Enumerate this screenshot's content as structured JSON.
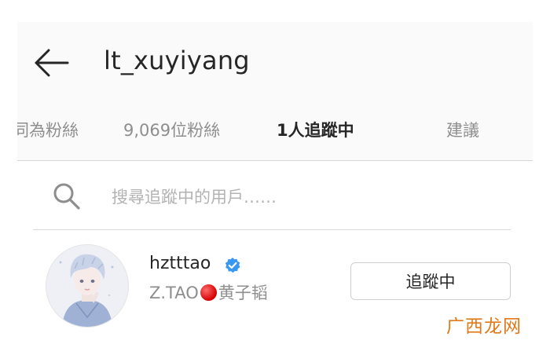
{
  "header": {
    "title": "lt_xuyiyang"
  },
  "tabs": [
    {
      "label": "同為粉絲",
      "active": false
    },
    {
      "label": "9,069位粉絲",
      "active": false
    },
    {
      "label": "1人追蹤中",
      "active": true
    },
    {
      "label": "建議",
      "active": false
    }
  ],
  "search": {
    "placeholder": "搜尋追蹤中的用戶……",
    "value": ""
  },
  "user": {
    "username": "hztttao",
    "verified": true,
    "fullname_prefix": "Z.TAO",
    "fullname_suffix": "黄子韬",
    "button_label": "追蹤中"
  },
  "watermark": {
    "text": "广西龙网",
    "color": "#e07a1a"
  },
  "colors": {
    "verified": "#3897f0",
    "secondary_text": "#8e8e8e",
    "primary_text": "#262626"
  }
}
